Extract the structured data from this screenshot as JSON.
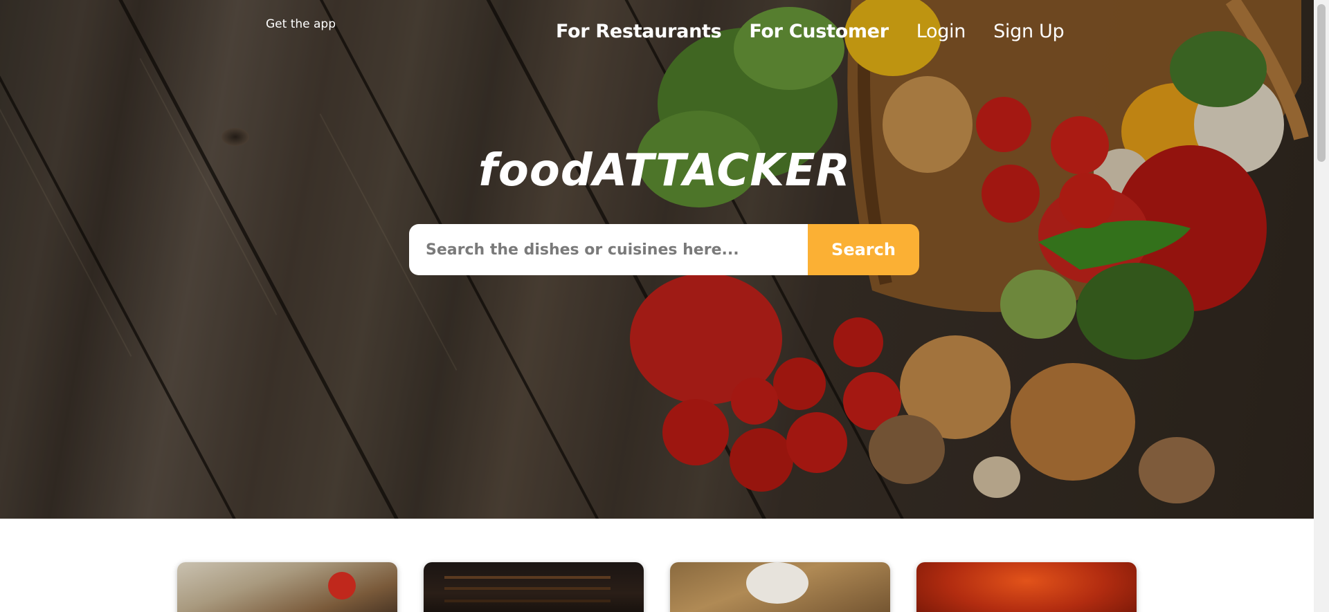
{
  "topbar": {
    "get_app_label": "Get the app"
  },
  "nav": {
    "items": [
      {
        "label": "For Restaurants"
      },
      {
        "label": "For Customer"
      },
      {
        "label": "Login"
      },
      {
        "label": "Sign Up"
      }
    ]
  },
  "hero": {
    "brand": "foodATTACKER",
    "search": {
      "placeholder": "Search the dishes or cuisines here...",
      "value": "",
      "button_label": "Search"
    }
  },
  "colors": {
    "accent": "#fbb034",
    "nav_text": "#ffffff"
  },
  "cards": [
    {
      "icon": "food-photo-tomatoes"
    },
    {
      "icon": "restaurant-interior-photo"
    },
    {
      "icon": "table-dishes-photo"
    },
    {
      "icon": "red-light-photo"
    }
  ]
}
